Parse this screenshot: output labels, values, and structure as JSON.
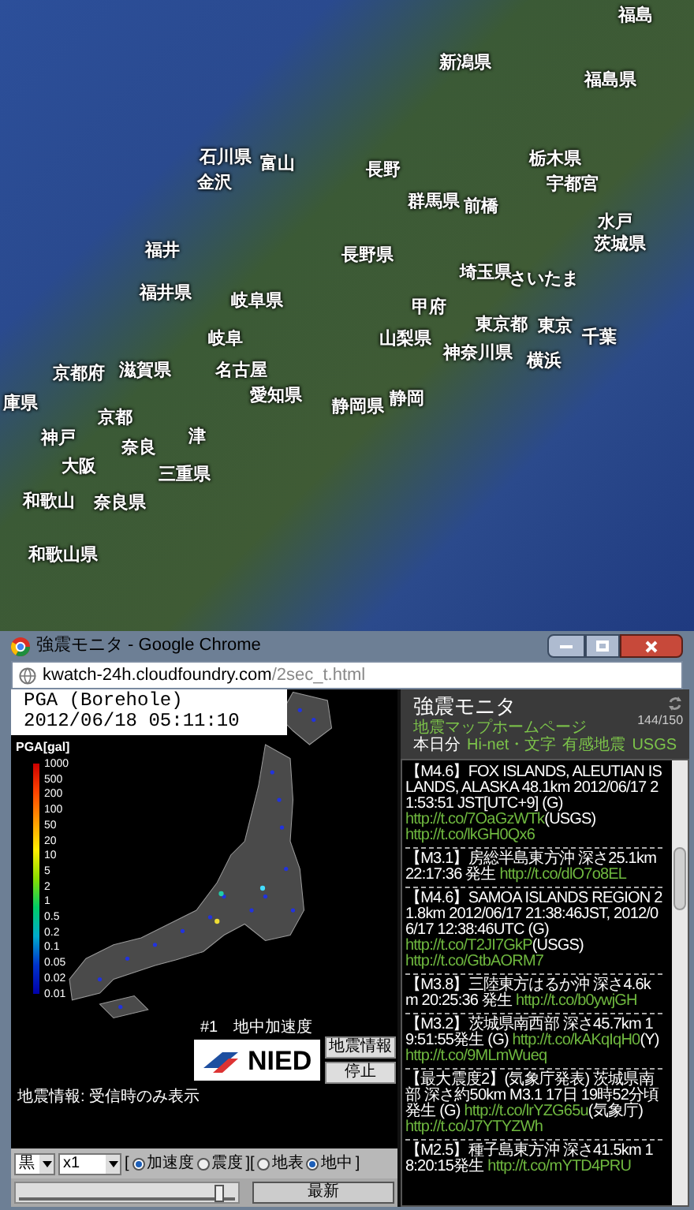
{
  "map": {
    "labels": [
      "福島",
      "新潟県",
      "福島県",
      "石川県",
      "富山",
      "長野",
      "栃木県",
      "金沢",
      "宇都宮",
      "群馬県",
      "前橋",
      "水戸",
      "福井",
      "長野県",
      "茨城県",
      "埼玉県",
      "さいたま",
      "福井県",
      "岐阜県",
      "甲府",
      "岐阜",
      "山梨県",
      "東京都",
      "東京",
      "千葉",
      "神奈川県",
      "京都府",
      "滋賀県",
      "名古屋",
      "横浜",
      "庫県",
      "愛知県",
      "静岡県",
      "静岡",
      "京都",
      "神戸",
      "奈良",
      "津",
      "大阪",
      "三重県",
      "和歌山",
      "奈良県",
      "和歌山県"
    ]
  },
  "window": {
    "title": "強震モニタ - Google Chrome",
    "url_host": "kwatch-24h.cloudfoundry.com",
    "url_path": "/2sec_t.html"
  },
  "monitor": {
    "header_title": "PGA (Borehole)",
    "timestamp": "2012/06/18 05:11:10",
    "legend_title": "PGA[gal]",
    "legend_ticks": [
      "1000",
      "500",
      "200",
      "100",
      "50",
      "20",
      "10",
      "5",
      "2",
      "1",
      "0.5",
      "0.2",
      "0.1",
      "0.05",
      "0.02",
      "0.01"
    ],
    "caption": "#1　地中加速度",
    "logo": "NIED",
    "info_button": "地震情報",
    "stop_button": "停止",
    "notice": "地震情報: 受信時のみ表示"
  },
  "controls": [
    {
      "kind": "select",
      "value": "黒"
    },
    {
      "kind": "select",
      "value": "x1"
    },
    {
      "kind": "bracket",
      "text": "["
    },
    {
      "kind": "radio",
      "label": "加速度",
      "selected": true
    },
    {
      "kind": "radio",
      "label": "震度",
      "selected": false
    },
    {
      "kind": "bracket",
      "text": "]["
    },
    {
      "kind": "radio",
      "label": "地表",
      "selected": false
    },
    {
      "kind": "radio",
      "label": "地中",
      "selected": true
    },
    {
      "kind": "bracket",
      "text": "]"
    }
  ],
  "slider": {
    "level": 0.93
  },
  "latest_button": "最新",
  "feed": {
    "title": "強震モニタ",
    "counter": "144/150",
    "home_link": "地震マップホームページ",
    "today_label": "本日分",
    "today_links": [
      "Hi-net・文字",
      "有感地震",
      "USGS"
    ],
    "items": [
      [
        {
          "kind": "text",
          "text": "【M4.6】FOX ISLANDS, ALEUTIAN ISLANDS, ALASKA 48.1km 2012/06/17 21:53:51 JST[UTC+9] (G)"
        },
        {
          "kind": "link",
          "text": "http://t.co/7OaGzWTk"
        },
        {
          "kind": "text",
          "text": "(USGS)"
        },
        {
          "kind": "link",
          "text": "http://t.co/lkGH0Qx6"
        }
      ],
      [
        {
          "kind": "text",
          "text": "【M3.1】房総半島東方沖 深さ25.1km 22:17:36 発生"
        },
        {
          "kind": "link",
          "text": "http://t.co/dlO7o8EL"
        }
      ],
      [
        {
          "kind": "text",
          "text": "【M4.6】SAMOA ISLANDS REGION 21.8km 2012/06/17 21:38:46JST, 2012/06/17 12:38:46UTC (G)"
        },
        {
          "kind": "link",
          "text": "http://t.co/T2JI7GkP"
        },
        {
          "kind": "text",
          "text": "(USGS)"
        },
        {
          "kind": "link",
          "text": "http://t.co/GtbAORM7"
        }
      ],
      [
        {
          "kind": "text",
          "text": "【M3.8】三陸東方はるか沖 深さ4.6km 20:25:36 発生"
        },
        {
          "kind": "link",
          "text": "http://t.co/b0ywjGH"
        }
      ],
      [
        {
          "kind": "text",
          "text": "【M3.2】茨城県南西部 深さ45.7km 19:51:55発生 (G)"
        },
        {
          "kind": "link",
          "text": "http://t.co/kAKqIqH0"
        },
        {
          "kind": "text",
          "text": "(Y)"
        },
        {
          "kind": "link",
          "text": "http://t.co/9MLmWueq"
        }
      ],
      [
        {
          "kind": "text",
          "text": "【最大震度2】(気象庁発表) 茨城県南部 深さ約50km M3.1 17日 19時52分頃発生 (G)"
        },
        {
          "kind": "link",
          "text": "http://t.co/lrYZG65u"
        },
        {
          "kind": "text",
          "text": "(気象庁)"
        },
        {
          "kind": "link",
          "text": "http://t.co/J7YTYZWh"
        }
      ],
      [
        {
          "kind": "text",
          "text": "【M2.5】種子島東方沖 深さ41.5km 18:20:15発生"
        },
        {
          "kind": "link",
          "text": "http://t.co/mYTD4PRU"
        }
      ]
    ]
  }
}
